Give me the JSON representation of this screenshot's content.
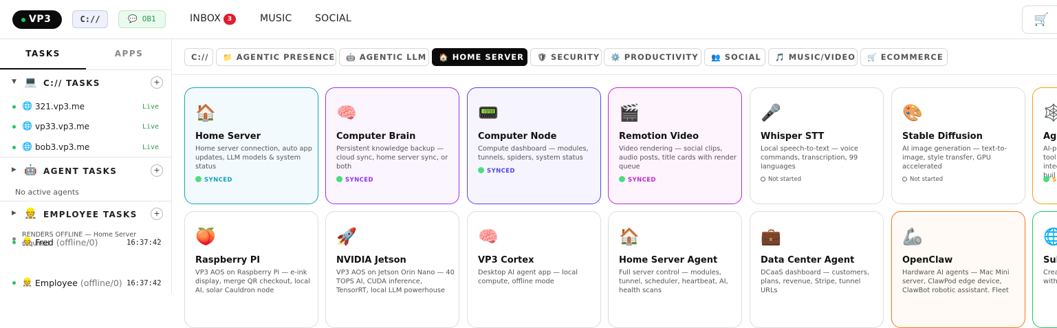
{
  "header": {
    "brand": "VP3",
    "path_pill": "C://",
    "ob_pill": "💬 OB1",
    "nav": [
      {
        "label": "INBOX",
        "badge": "3"
      },
      {
        "label": "MUSIC"
      },
      {
        "label": "SOCIAL"
      }
    ],
    "cart_icon": "🛒"
  },
  "sidebar": {
    "tabs": [
      "TASKS",
      "APPS"
    ],
    "c_tasks": {
      "title": "C:// TASKS",
      "icon": "💻",
      "sites": [
        {
          "name": "321.vp3.me",
          "status": "Live"
        },
        {
          "name": "vp33.vp3.me",
          "status": "Live"
        },
        {
          "name": "bob3.vp3.me",
          "status": "Live"
        }
      ]
    },
    "agent_tasks": {
      "title": "AGENT TASKS",
      "icon": "🤖",
      "empty": "No active agents"
    },
    "employee_tasks": {
      "title": "EMPLOYEE TASKS",
      "icon": "👷",
      "offline_note": "RENDERS OFFLINE — Home Server required",
      "employees": [
        {
          "name": "Fred",
          "status": "(offline/0)",
          "time": "16:37:42"
        },
        {
          "name": "Employee",
          "status": "(offline/0)",
          "time": "16:37:42"
        }
      ]
    }
  },
  "categories": [
    {
      "icon": "",
      "label": "C://"
    },
    {
      "icon": "📁",
      "label": "AGENTIC PRESENCE"
    },
    {
      "icon": "🤖",
      "label": "AGENTIC LLM"
    },
    {
      "icon": "🏠",
      "label": "HOME SERVER",
      "selected": true
    },
    {
      "icon": "🛡",
      "label": "SECURITY"
    },
    {
      "icon": "⚙️",
      "label": "PRODUCTIVITY"
    },
    {
      "icon": "👥",
      "label": "SOCIAL"
    },
    {
      "icon": "🎵",
      "label": "MUSIC/VIDEO"
    },
    {
      "icon": "🛒",
      "label": "ECOMMERCE"
    }
  ],
  "cards_row1": [
    {
      "icon": "🏠",
      "title": "Home Server",
      "desc": "Home server connection, auto app updates, LLM models & system status",
      "status": "SYNCED",
      "color": "#14a3b8"
    },
    {
      "icon": "🧠",
      "title": "Computer Brain",
      "desc": "Persistent knowledge backup — cloud sync, home server sync, or both",
      "status": "SYNCED",
      "color": "#9333ea"
    },
    {
      "icon": "📟",
      "title": "Computer Node",
      "desc": "Compute dashboard — modules, tunnels, spiders, system status",
      "status": "SYNCED",
      "color": "#4f46e5"
    },
    {
      "icon": "🎬",
      "title": "Remotion Video",
      "desc": "Video rendering — social clips, audio posts, title cards with render queue",
      "status": "SYNCED",
      "color": "#c026d3"
    },
    {
      "icon": "🎤",
      "title": "Whisper STT",
      "desc": "Local speech-to-text — voice commands, transcription, 99 languages",
      "status": "Not started"
    },
    {
      "icon": "🎨",
      "title": "Stable Diffusion",
      "desc": "AI image generation — text-to-image, style transfer, GPU accelerated",
      "status": "Not started"
    },
    {
      "icon": "🕸️",
      "title": "Ag",
      "desc": "AI-p tool integ buil",
      "status": "S",
      "color": "#f59e0b"
    }
  ],
  "cards_row2": [
    {
      "icon": "🍑",
      "title": "Raspberry PI",
      "desc": "VP3 AOS on Raspberry Pi — e-ink display, merge QR checkout, local AI, solar Cauldron node"
    },
    {
      "icon": "🚀",
      "title": "NVIDIA Jetson",
      "desc": "VP3 AOS on Jetson Orin Nano — 40 TOPS AI, CUDA inference, TensorRT, local LLM powerhouse"
    },
    {
      "icon": "🧠",
      "title": "VP3 Cortex",
      "desc": "Desktop AI agent app — local compute, offline mode"
    },
    {
      "icon": "🏠",
      "title": "Home Server Agent",
      "desc": "Full server control — modules, tunnel, scheduler, heartbeat, AI, health scans"
    },
    {
      "icon": "💼",
      "title": "Data Center Agent",
      "desc": "DCaaS dashboard — customers, plans, revenue, Stripe, tunnel URLs"
    },
    {
      "icon": "🦾",
      "title": "OpenClaw",
      "desc": "Hardware AI agents — Mac Mini server, ClawPod edge device, ClawBot robotic assistant. Fleet"
    },
    {
      "icon": "🌐",
      "title": "Sul",
      "desc": "Crea with"
    }
  ]
}
